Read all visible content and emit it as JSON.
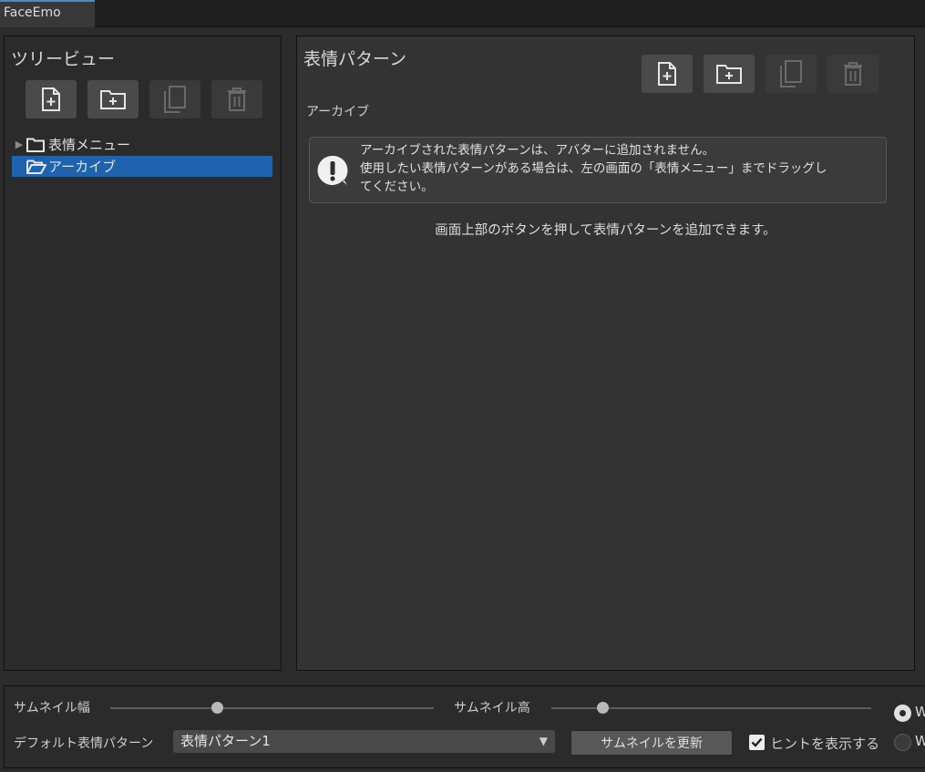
{
  "window": {
    "tab_title": "FaceEmo"
  },
  "tree_view": {
    "title": "ツリービュー",
    "toolbar": [
      "add-item-icon",
      "add-folder-icon",
      "copy-icon",
      "delete-icon"
    ],
    "items": [
      {
        "label": "表情メニュー",
        "expanded": false,
        "selected": false,
        "icon": "folder-icon"
      },
      {
        "label": "アーカイブ",
        "expanded": false,
        "selected": true,
        "icon": "folder-open-icon"
      }
    ]
  },
  "main": {
    "title": "表情パターン",
    "toolbar": [
      "add-item-icon",
      "add-folder-icon",
      "copy-icon",
      "delete-icon"
    ],
    "section_label": "アーカイブ",
    "help_lines": [
      "アーカイブされた表情パターンは、アバターに追加されません。",
      "使用したい表情パターンがある場合は、左の画面の「表情メニュー」までドラッグし",
      "てください。"
    ],
    "center_message": "画面上部のボタンを押して表情パターンを追加できます。"
  },
  "bottom": {
    "thumb_width_label": "サムネイル幅",
    "thumb_width_value": 0.33,
    "thumb_height_label": "サムネイル高",
    "thumb_height_value": 0.16,
    "default_pattern_label": "デフォルト表情パターン",
    "default_pattern_value": "表情パターン1",
    "update_thumbnail_button": "サムネイルを更新",
    "show_hints_label": "ヒントを表示する",
    "show_hints_checked": true,
    "radio_1_label": "W",
    "radio_1_selected": true,
    "radio_2_label": "W",
    "radio_2_selected": false
  },
  "colors": {
    "selection": "#1f63ae",
    "background": "#2b2b2b",
    "tab_accent": "#4c88c6"
  }
}
